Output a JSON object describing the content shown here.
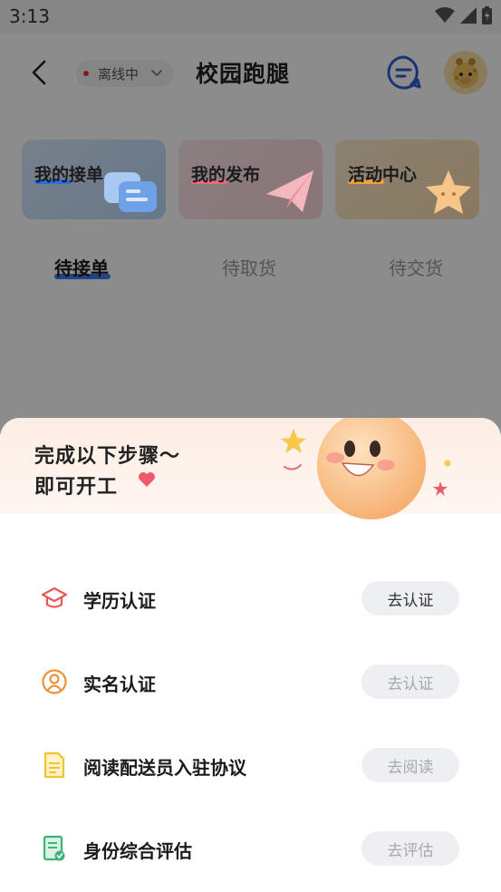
{
  "status_bar": {
    "time": "3:13"
  },
  "header": {
    "online_status": "离线中",
    "title": "校园跑腿"
  },
  "cards": [
    {
      "label": "我的接单"
    },
    {
      "label": "我的发布"
    },
    {
      "label": "活动中心"
    }
  ],
  "tabs": [
    {
      "label": "待接单",
      "active": true
    },
    {
      "label": "待取货",
      "active": false
    },
    {
      "label": "待交货",
      "active": false
    }
  ],
  "sheet": {
    "title_line1": "完成以下步骤～",
    "title_line2": "即可开工",
    "steps": [
      {
        "icon": "graduation-cap-icon",
        "label": "学历认证",
        "button": "去认证",
        "enabled": true
      },
      {
        "icon": "person-circle-icon",
        "label": "实名认证",
        "button": "去认证",
        "enabled": false
      },
      {
        "icon": "document-icon",
        "label": "阅读配送员入驻协议",
        "button": "去阅读",
        "enabled": false
      },
      {
        "icon": "assessment-icon",
        "label": "身份综合评估",
        "button": "去评估",
        "enabled": false
      }
    ]
  },
  "colors": {
    "accent_blue": "#3b7cf0",
    "step_red": "#e8565a",
    "step_orange": "#f0913c",
    "step_yellow": "#f2c230",
    "step_green": "#3cb37a"
  }
}
